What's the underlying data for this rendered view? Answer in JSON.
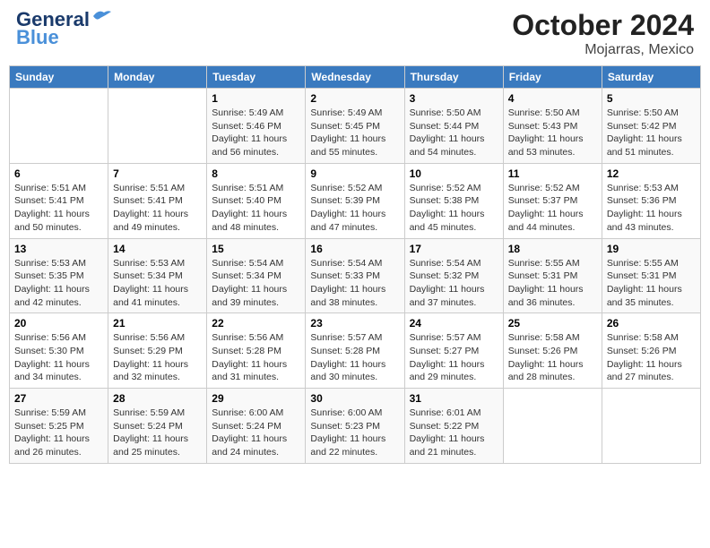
{
  "header": {
    "logo_line1": "General",
    "logo_line2": "Blue",
    "month_title": "October 2024",
    "location": "Mojarras, Mexico"
  },
  "weekdays": [
    "Sunday",
    "Monday",
    "Tuesday",
    "Wednesday",
    "Thursday",
    "Friday",
    "Saturday"
  ],
  "weeks": [
    [
      {
        "day": "",
        "info": ""
      },
      {
        "day": "",
        "info": ""
      },
      {
        "day": "1",
        "info": "Sunrise: 5:49 AM\nSunset: 5:46 PM\nDaylight: 11 hours and 56 minutes."
      },
      {
        "day": "2",
        "info": "Sunrise: 5:49 AM\nSunset: 5:45 PM\nDaylight: 11 hours and 55 minutes."
      },
      {
        "day": "3",
        "info": "Sunrise: 5:50 AM\nSunset: 5:44 PM\nDaylight: 11 hours and 54 minutes."
      },
      {
        "day": "4",
        "info": "Sunrise: 5:50 AM\nSunset: 5:43 PM\nDaylight: 11 hours and 53 minutes."
      },
      {
        "day": "5",
        "info": "Sunrise: 5:50 AM\nSunset: 5:42 PM\nDaylight: 11 hours and 51 minutes."
      }
    ],
    [
      {
        "day": "6",
        "info": "Sunrise: 5:51 AM\nSunset: 5:41 PM\nDaylight: 11 hours and 50 minutes."
      },
      {
        "day": "7",
        "info": "Sunrise: 5:51 AM\nSunset: 5:41 PM\nDaylight: 11 hours and 49 minutes."
      },
      {
        "day": "8",
        "info": "Sunrise: 5:51 AM\nSunset: 5:40 PM\nDaylight: 11 hours and 48 minutes."
      },
      {
        "day": "9",
        "info": "Sunrise: 5:52 AM\nSunset: 5:39 PM\nDaylight: 11 hours and 47 minutes."
      },
      {
        "day": "10",
        "info": "Sunrise: 5:52 AM\nSunset: 5:38 PM\nDaylight: 11 hours and 45 minutes."
      },
      {
        "day": "11",
        "info": "Sunrise: 5:52 AM\nSunset: 5:37 PM\nDaylight: 11 hours and 44 minutes."
      },
      {
        "day": "12",
        "info": "Sunrise: 5:53 AM\nSunset: 5:36 PM\nDaylight: 11 hours and 43 minutes."
      }
    ],
    [
      {
        "day": "13",
        "info": "Sunrise: 5:53 AM\nSunset: 5:35 PM\nDaylight: 11 hours and 42 minutes."
      },
      {
        "day": "14",
        "info": "Sunrise: 5:53 AM\nSunset: 5:34 PM\nDaylight: 11 hours and 41 minutes."
      },
      {
        "day": "15",
        "info": "Sunrise: 5:54 AM\nSunset: 5:34 PM\nDaylight: 11 hours and 39 minutes."
      },
      {
        "day": "16",
        "info": "Sunrise: 5:54 AM\nSunset: 5:33 PM\nDaylight: 11 hours and 38 minutes."
      },
      {
        "day": "17",
        "info": "Sunrise: 5:54 AM\nSunset: 5:32 PM\nDaylight: 11 hours and 37 minutes."
      },
      {
        "day": "18",
        "info": "Sunrise: 5:55 AM\nSunset: 5:31 PM\nDaylight: 11 hours and 36 minutes."
      },
      {
        "day": "19",
        "info": "Sunrise: 5:55 AM\nSunset: 5:31 PM\nDaylight: 11 hours and 35 minutes."
      }
    ],
    [
      {
        "day": "20",
        "info": "Sunrise: 5:56 AM\nSunset: 5:30 PM\nDaylight: 11 hours and 34 minutes."
      },
      {
        "day": "21",
        "info": "Sunrise: 5:56 AM\nSunset: 5:29 PM\nDaylight: 11 hours and 32 minutes."
      },
      {
        "day": "22",
        "info": "Sunrise: 5:56 AM\nSunset: 5:28 PM\nDaylight: 11 hours and 31 minutes."
      },
      {
        "day": "23",
        "info": "Sunrise: 5:57 AM\nSunset: 5:28 PM\nDaylight: 11 hours and 30 minutes."
      },
      {
        "day": "24",
        "info": "Sunrise: 5:57 AM\nSunset: 5:27 PM\nDaylight: 11 hours and 29 minutes."
      },
      {
        "day": "25",
        "info": "Sunrise: 5:58 AM\nSunset: 5:26 PM\nDaylight: 11 hours and 28 minutes."
      },
      {
        "day": "26",
        "info": "Sunrise: 5:58 AM\nSunset: 5:26 PM\nDaylight: 11 hours and 27 minutes."
      }
    ],
    [
      {
        "day": "27",
        "info": "Sunrise: 5:59 AM\nSunset: 5:25 PM\nDaylight: 11 hours and 26 minutes."
      },
      {
        "day": "28",
        "info": "Sunrise: 5:59 AM\nSunset: 5:24 PM\nDaylight: 11 hours and 25 minutes."
      },
      {
        "day": "29",
        "info": "Sunrise: 6:00 AM\nSunset: 5:24 PM\nDaylight: 11 hours and 24 minutes."
      },
      {
        "day": "30",
        "info": "Sunrise: 6:00 AM\nSunset: 5:23 PM\nDaylight: 11 hours and 22 minutes."
      },
      {
        "day": "31",
        "info": "Sunrise: 6:01 AM\nSunset: 5:22 PM\nDaylight: 11 hours and 21 minutes."
      },
      {
        "day": "",
        "info": ""
      },
      {
        "day": "",
        "info": ""
      }
    ]
  ]
}
